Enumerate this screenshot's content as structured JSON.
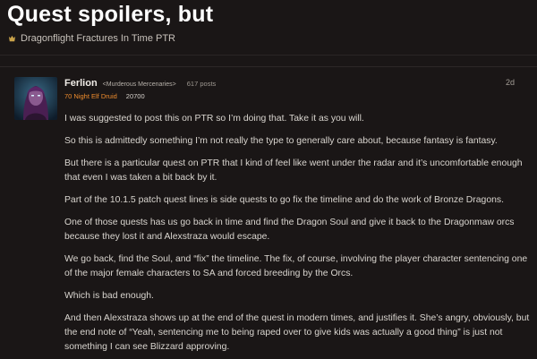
{
  "topic": {
    "title": "Quest spoilers, but",
    "category": "Dragonflight Fractures In Time PTR",
    "category_icon": "category-icon"
  },
  "post": {
    "author": "Ferlion",
    "guild": "<Murderous Mercenaries>",
    "post_count": "617 posts",
    "character": "70 Night Elf Druid",
    "achievement_points": "20700",
    "date": "2d",
    "paragraphs": [
      "I was suggested to post this on PTR so I’m doing that. Take it as you will.",
      "So this is admittedly something I’m not really the type to generally care about, because fantasy is fantasy.",
      "But there is a particular quest on PTR that I kind of feel like went under the radar and it’s uncomfortable enough that even I was taken a bit back by it.",
      "Part of the 10.1.5 patch quest lines is side quests to go fix the timeline and do the work of Bronze Dragons.",
      "One of those quests has us go back in time and find the Dragon Soul and give it back to the Dragonmaw orcs because they lost it and Alexstraza would escape.",
      "We go back, find the Soul, and “fix” the timeline. The fix, of course, involving the player character sentencing one of the major female characters to SA and forced breeding by the Orcs.",
      "Which is bad enough.",
      "And then Alexstraza shows up at the end of the quest in modern times, and justifies it. She’s angry, obviously, but the end note of “Yeah, sentencing me to being raped over to give kids was actually a good thing” is just not something I can see Blizzard approving."
    ]
  },
  "colors": {
    "background": "#1a1616",
    "class_color": "#ef8c2d",
    "title": "#ffffff"
  }
}
